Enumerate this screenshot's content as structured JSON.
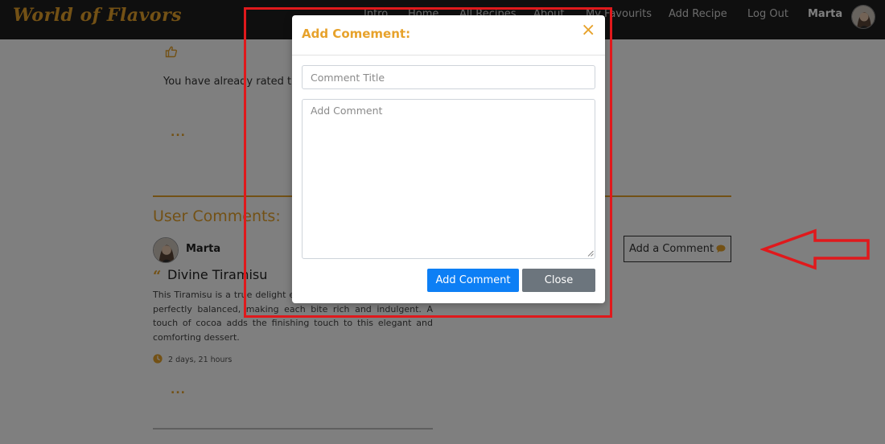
{
  "navbar": {
    "brand": "World of Flavors",
    "links": [
      "Intro",
      "Home",
      "All Recipes",
      "About",
      "My Favourits",
      "Add Recipe",
      "Log Out"
    ],
    "user": "Marta",
    "avatar_icon": "user-avatar-photo"
  },
  "rating": {
    "message": "You have already rated thi",
    "icon": "thumbs-up-icon"
  },
  "more_label": "...",
  "comments": {
    "section_title": "User Comments:",
    "add_button_label": "Add a Comment",
    "items": [
      {
        "user": "Marta",
        "title": "Divine Tiramisu",
        "body": "This Tiramisu is a true delight espresso-soaked ladyfingers are perfectly balanced, making each bite rich and indulgent. A touch of cocoa adds the finishing touch to this elegant and comforting dessert.",
        "time": "2 days, 21 hours"
      }
    ]
  },
  "modal": {
    "title": "Add Comement:",
    "close_symbol": "×",
    "title_placeholder": "Comment Title",
    "comment_placeholder": "Add Comment",
    "submit_label": "Add Comment",
    "cancel_label": "Close"
  },
  "colors": {
    "accent": "#e7a22b",
    "navbar_bg": "#1e1e1e",
    "primary_button": "#0d7ff5",
    "secondary_button": "#6c757d",
    "annotation": "#e0191c"
  }
}
